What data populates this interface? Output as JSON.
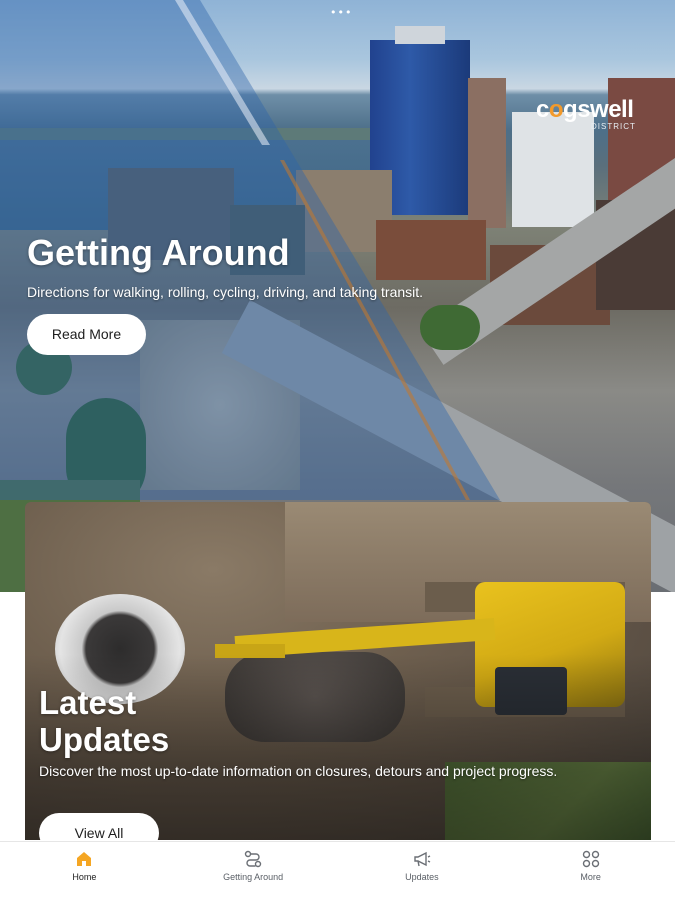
{
  "status": {
    "dots": "•••"
  },
  "brand": {
    "logo_pre": "c",
    "logo_o": "o",
    "logo_post": "gswell",
    "logo_sub": "DISTRICT"
  },
  "hero": {
    "title": "Getting Around",
    "subtitle": "Directions for walking, rolling, cycling, driving, and taking transit.",
    "button_label": "Read More"
  },
  "updates": {
    "title_line1": "Latest",
    "title_line2": "Updates",
    "subtitle": "Discover the most up-to-date information on closures, detours and project progress.",
    "button_label": "View All"
  },
  "tabbar": {
    "active_color": "#f5a623",
    "items": [
      {
        "label": "Home",
        "icon": "home-icon",
        "active": true
      },
      {
        "label": "Getting Around",
        "icon": "route-icon",
        "active": false
      },
      {
        "label": "Updates",
        "icon": "megaphone-icon",
        "active": false
      },
      {
        "label": "More",
        "icon": "grid-icon",
        "active": false
      }
    ]
  }
}
